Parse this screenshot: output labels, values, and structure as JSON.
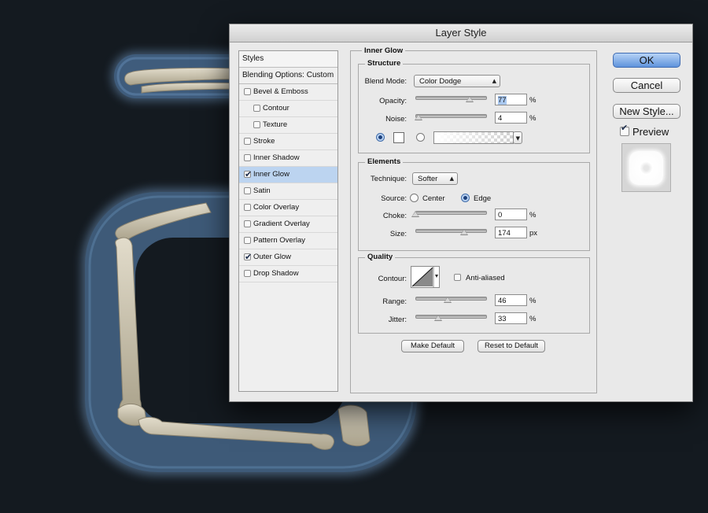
{
  "window": {
    "title": "Layer Style"
  },
  "styles_list": {
    "header": "Styles",
    "blending_options": "Blending Options: Custom",
    "items": [
      {
        "label": "Bevel & Emboss",
        "checked": false,
        "indent": false,
        "selected": false
      },
      {
        "label": "Contour",
        "checked": false,
        "indent": true,
        "selected": false
      },
      {
        "label": "Texture",
        "checked": false,
        "indent": true,
        "selected": false
      },
      {
        "label": "Stroke",
        "checked": false,
        "indent": false,
        "selected": false
      },
      {
        "label": "Inner Shadow",
        "checked": false,
        "indent": false,
        "selected": false
      },
      {
        "label": "Inner Glow",
        "checked": true,
        "indent": false,
        "selected": true
      },
      {
        "label": "Satin",
        "checked": false,
        "indent": false,
        "selected": false
      },
      {
        "label": "Color Overlay",
        "checked": false,
        "indent": false,
        "selected": false
      },
      {
        "label": "Gradient Overlay",
        "checked": false,
        "indent": false,
        "selected": false
      },
      {
        "label": "Pattern Overlay",
        "checked": false,
        "indent": false,
        "selected": false
      },
      {
        "label": "Outer Glow",
        "checked": true,
        "indent": false,
        "selected": false
      },
      {
        "label": "Drop Shadow",
        "checked": false,
        "indent": false,
        "selected": false
      }
    ]
  },
  "inner_glow": {
    "title": "Inner Glow",
    "structure": {
      "title": "Structure",
      "blend_mode_label": "Blend Mode:",
      "blend_mode_value": "Color Dodge",
      "opacity_label": "Opacity:",
      "opacity_value": "77",
      "opacity_unit": "%",
      "opacity_level": 0.77,
      "noise_label": "Noise:",
      "noise_value": "4",
      "noise_unit": "%",
      "noise_level": 0.04,
      "color_mode": "solid-color"
    },
    "elements": {
      "title": "Elements",
      "technique_label": "Technique:",
      "technique_value": "Softer",
      "source_label": "Source:",
      "source_center": "Center",
      "source_edge": "Edge",
      "source_selected": "Edge",
      "choke_label": "Choke:",
      "choke_value": "0",
      "choke_unit": "%",
      "choke_level": 0.0,
      "size_label": "Size:",
      "size_value": "174",
      "size_unit": "px",
      "size_level": 0.7
    },
    "quality": {
      "title": "Quality",
      "contour_label": "Contour:",
      "anti_aliased_label": "Anti-aliased",
      "anti_aliased_checked": false,
      "range_label": "Range:",
      "range_value": "46",
      "range_unit": "%",
      "range_level": 0.46,
      "jitter_label": "Jitter:",
      "jitter_value": "33",
      "jitter_unit": "%",
      "jitter_level": 0.33
    },
    "make_default": "Make Default",
    "reset_to_default": "Reset to Default"
  },
  "buttons": {
    "ok": "OK",
    "cancel": "Cancel",
    "new_style": "New Style..."
  },
  "preview": {
    "label": "Preview",
    "checked": true
  },
  "colors": {
    "accent": "#5f93dc",
    "selection": "#bcd4f0",
    "canvas_bg": "#141a20",
    "glyph_blue": "#3e5a78",
    "bone": "#c9c0a8"
  }
}
